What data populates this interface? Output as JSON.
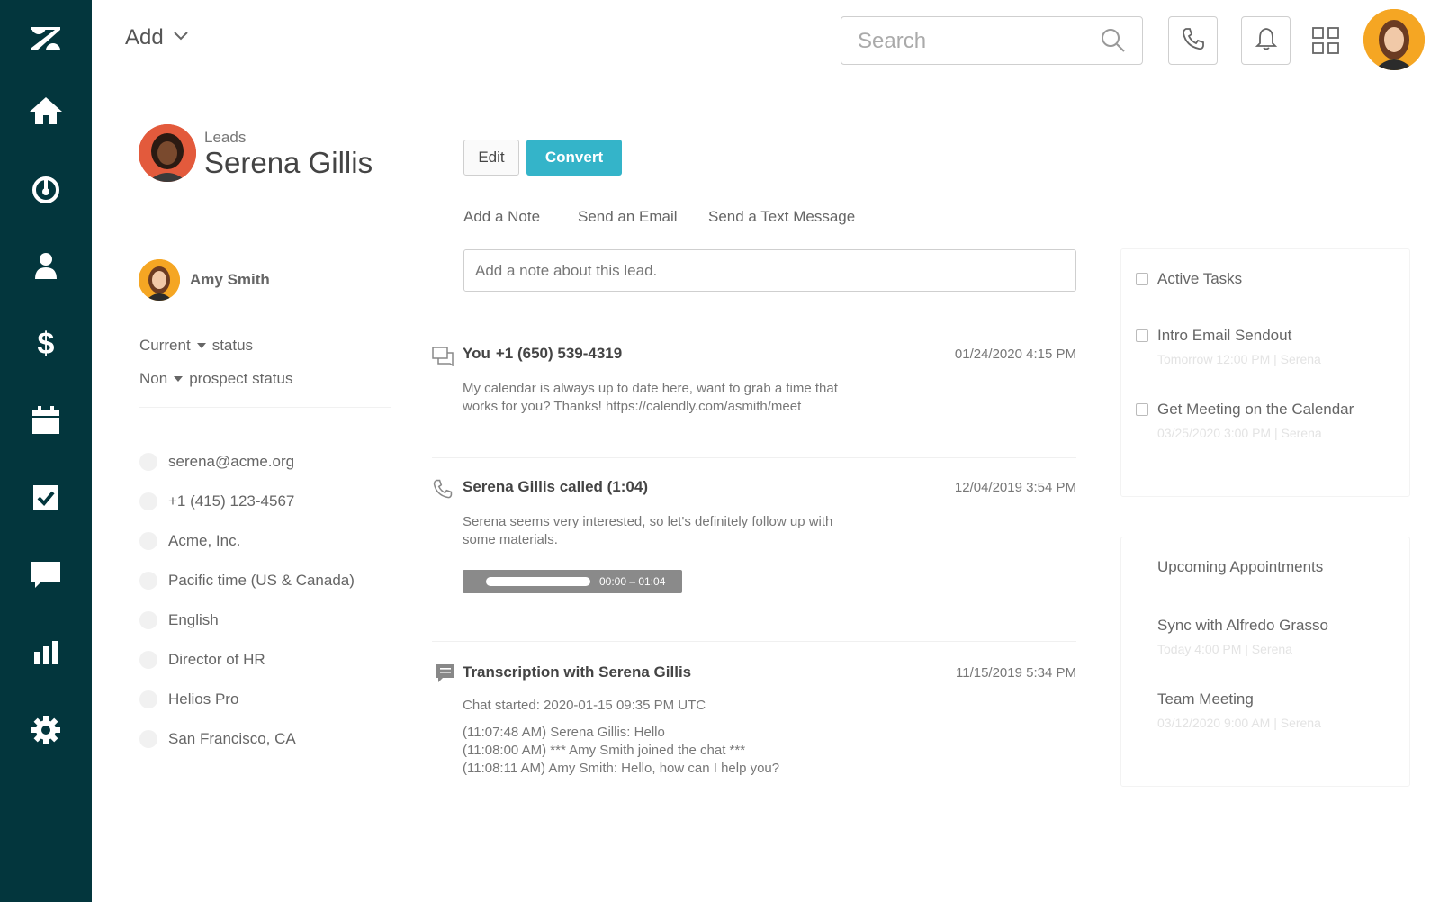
{
  "topbar": {
    "add_label": "Add",
    "search_placeholder": "Search"
  },
  "lead": {
    "type_label": "Leads",
    "name": "Serena Gillis",
    "edit_label": "Edit",
    "convert_label": "Convert"
  },
  "actions": {
    "add_note": "Add a Note",
    "send_email": "Send an Email",
    "send_text": "Send a Text Message",
    "note_placeholder": "Add a note about this lead."
  },
  "details": {
    "owner": "Amy Smith",
    "status_1": {
      "value": "Current",
      "label": "status"
    },
    "status_2": {
      "value": "Non",
      "label": "prospect status"
    },
    "email": "serena@acme.org",
    "phone": "+1 (415) 123-4567",
    "company": "Acme, Inc.",
    "timezone": "Pacific time (US & Canada)",
    "language": "English",
    "title": "Director of HR",
    "product": "Helios Pro",
    "location": "San Francisco, CA"
  },
  "feed": [
    {
      "icon": "chat-bubbles-icon",
      "title": "You",
      "sub": "+1 (650) 539-4319",
      "time": "01/24/2020 4:15 PM",
      "body": [
        "My calendar is always up to date here, want to grab a time that",
        "works for you? Thanks! https://calendly.com/asmith/meet"
      ]
    },
    {
      "icon": "phone-icon",
      "title": "Serena Gillis called (1:04)",
      "time": "12/04/2019 3:54 PM",
      "body": [
        "Serena seems very interested, so let's definitely follow up with",
        "some materials."
      ],
      "audio_time": "00:00 – 01:04",
      "audio_progress": 0.0
    },
    {
      "icon": "transcript-icon",
      "title": "Transcription with Serena Gillis",
      "time": "11/15/2019 5:34 PM",
      "chat_started": "Chat started: 2020-01-15 09:35 PM UTC",
      "lines": [
        "(11:07:48 AM) Serena Gillis: Hello",
        "(11:08:00 AM) *** Amy Smith joined the chat ***",
        "(11:08:11 AM) Amy Smith: Hello, how can I help you?"
      ]
    }
  ],
  "tasks": {
    "header": "Active Tasks",
    "items": [
      {
        "title": "Intro Email Sendout",
        "meta": "Tomorrow 12:00 PM | Serena"
      },
      {
        "title": "Get Meeting on the Calendar",
        "meta": "03/25/2020 3:00 PM | Serena"
      }
    ]
  },
  "appointments": {
    "header": "Upcoming Appointments",
    "items": [
      {
        "title": "Sync with Alfredo Grasso",
        "meta": "Today 4:00 PM | Serena"
      },
      {
        "title": "Team Meeting",
        "meta": "03/12/2020 9:00 AM | Serena"
      }
    ]
  },
  "colors": {
    "sidebar": "#03363d",
    "accent": "#34b4c9"
  }
}
